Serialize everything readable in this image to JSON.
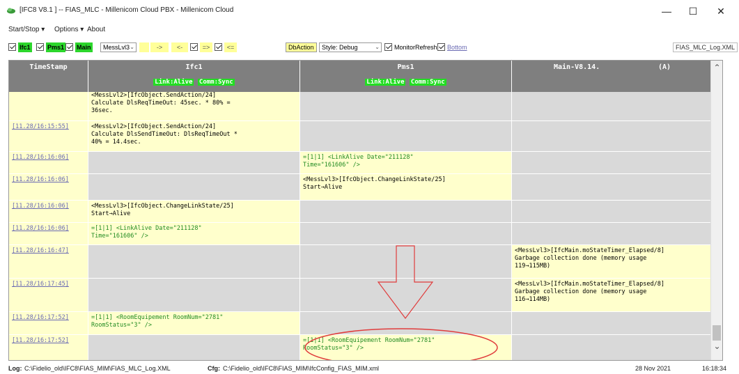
{
  "window": {
    "title": "[IFC8 V8.1        ] -- FIAS_MLC - Millenicom Cloud PBX - Millenicom Cloud",
    "minimize": "—",
    "maximize": "☐",
    "close": "✕"
  },
  "menu": [
    "Start/Stop ▾",
    "Options ▾",
    "About"
  ],
  "toolbar": {
    "chk_ifc1": "Ifc1",
    "chk_pms1": "Pms1",
    "chk_main": "Main",
    "combo_level": "MessLvl3",
    "arrow1": "->",
    "arrow2": "<-",
    "chk_dir1": "=>",
    "chk_dir2": "<=",
    "db_action": "DbAction",
    "style": "Style: Debug",
    "monitor_refresh": "MonitorRefresh",
    "bottom": "Bottom",
    "log_file": "FIAS_MLC_Log.XML"
  },
  "grid": {
    "headers": {
      "timestamp": "TimeStamp",
      "ifc1": "Ifc1",
      "ifc1_status": [
        "Link:Alive",
        "Comm:Sync"
      ],
      "pms1": "Pms1",
      "pms1_status": [
        "Link:Alive",
        "Comm:Sync"
      ],
      "main": "Main-V8.14.",
      "main_suffix": "(A)"
    },
    "rows": [
      {
        "ts": "",
        "ifc1": "<MessLvl2>[IfcObject.SendAction/24]\nCalculate DlsReqTimeOut: 45sec. * 80% =\n36sec.",
        "pms1": "",
        "main": ""
      },
      {
        "ts": "[11.28/16:15:55]",
        "ifc1": "<MessLvl2>[IfcObject.SendAction/24]\nCalculate DlsSendTimeOut: DlsReqTimeOut *\n40% = 14.4sec.",
        "pms1": "",
        "main": ""
      },
      {
        "ts": "[11.28/16:16:06]",
        "ifc1": "",
        "pms1": "=[1|1] <LinkAlive Date=\"211128\"\nTime=\"161606\" />",
        "main": ""
      },
      {
        "ts": "[11.28/16:16:06]",
        "ifc1": "",
        "pms1": "<MessLvl3>[IfcObject.ChangeLinkState/25]\nStart→Alive",
        "main": ""
      },
      {
        "ts": "[11.28/16:16:06]",
        "ifc1": "<MessLvl3>[IfcObject.ChangeLinkState/25]\nStart→Alive",
        "pms1": "",
        "main": ""
      },
      {
        "ts": "[11.28/16:16:06]",
        "ifc1": "=[1|1] <LinkAlive Date=\"211128\"\nTime=\"161606\" />",
        "pms1": "",
        "main": ""
      },
      {
        "ts": "[11.28/16:16:47]",
        "ifc1": "",
        "pms1": "",
        "main": "<MessLvl3>[IfcMain.moStateTimer_Elapsed/8]\nGarbage collection done (memory usage\n119→115MB)"
      },
      {
        "ts": "[11.28/16:17:45]",
        "ifc1": "",
        "pms1": "",
        "main": "<MessLvl3>[IfcMain.moStateTimer_Elapsed/8]\nGarbage collection done (memory usage\n116→114MB)"
      },
      {
        "ts": "[11.28/16:17:52]",
        "ifc1": "=[1|1] <RoomEquipement RoomNum=\"2781\"\nRoomStatus=\"3\" />",
        "pms1": "",
        "main": ""
      },
      {
        "ts": "[11.28/16:17:52]",
        "ifc1": "",
        "pms1": "=[1|1] <RoomEquipement RoomNum=\"2781\"\nRoomStatus=\"3\" />",
        "main": ""
      }
    ]
  },
  "statusbar": {
    "log_label": "Log:",
    "log_path": "C:\\Fidelio_old\\IFC8\\FIAS_MIM\\FIAS_MLC_Log.XML",
    "cfg_label": "Cfg:",
    "cfg_path": "C:\\Fidelio_old\\IFC8\\FIAS_MIM\\IfcConfig_FIAS_MIM.xml",
    "date": "28 Nov 2021",
    "time": "16:18:34"
  },
  "colors": {
    "header_bg": "#7f7f7f",
    "cell_yellow": "#ffffcc",
    "cell_grey": "#d9d9d9",
    "status_green": "#22dd22",
    "annotation_red": "#e03c3c"
  }
}
